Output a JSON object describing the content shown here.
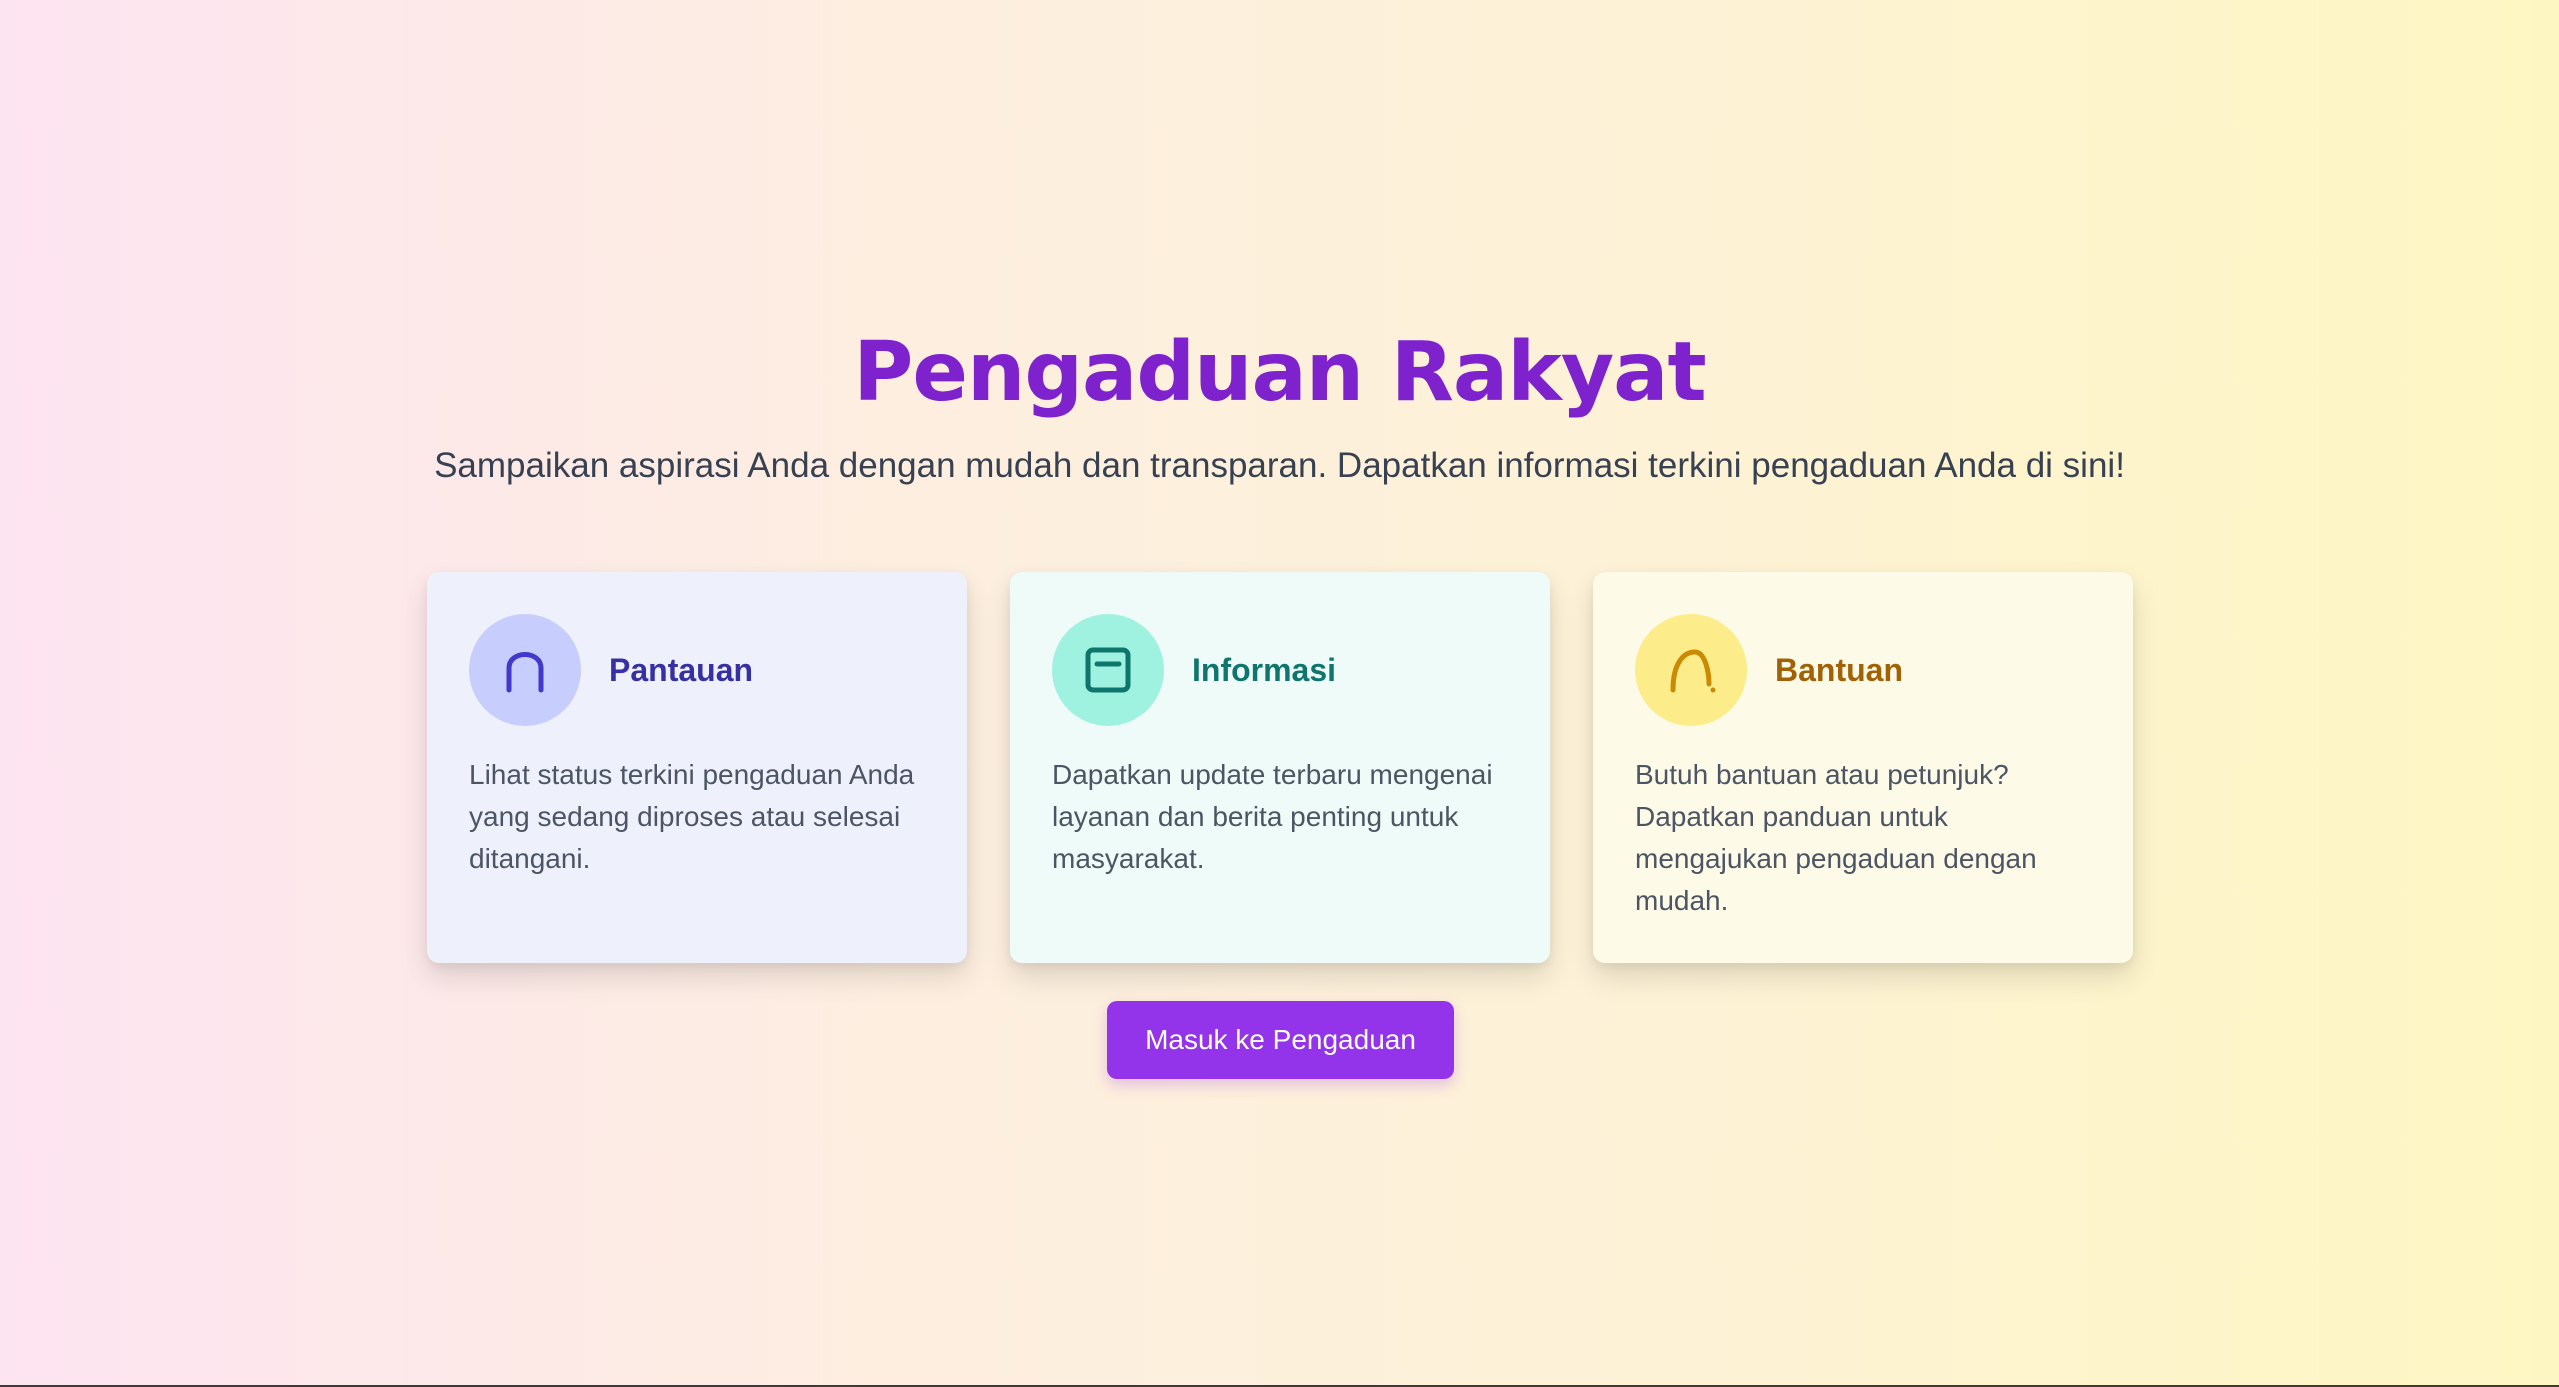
{
  "hero": {
    "title": "Pengaduan Rakyat",
    "subtitle": "Sampaikan aspirasi Anda dengan mudah dan transparan. Dapatkan informasi terkini pengaduan Anda di sini!"
  },
  "cards": [
    {
      "title": "Pantauan",
      "description": "Lihat status terkini pengaduan Anda yang sedang diproses atau selesai ditangani.",
      "icon": "monitor-arch-icon",
      "accent": "#3730a3"
    },
    {
      "title": "Informasi",
      "description": "Dapatkan update terbaru mengenai layanan dan berita penting untuk masyarakat.",
      "icon": "info-box-icon",
      "accent": "#0f766e"
    },
    {
      "title": "Bantuan",
      "description": "Butuh bantuan atau petunjuk? Dapatkan panduan untuk mengajukan pengaduan dengan mudah.",
      "icon": "help-curve-icon",
      "accent": "#a16207"
    }
  ],
  "cta": {
    "label": "Masuk ke Pengaduan",
    "color": "#9333ea"
  },
  "colors": {
    "title": "#7e22ce",
    "text": "#374151"
  }
}
